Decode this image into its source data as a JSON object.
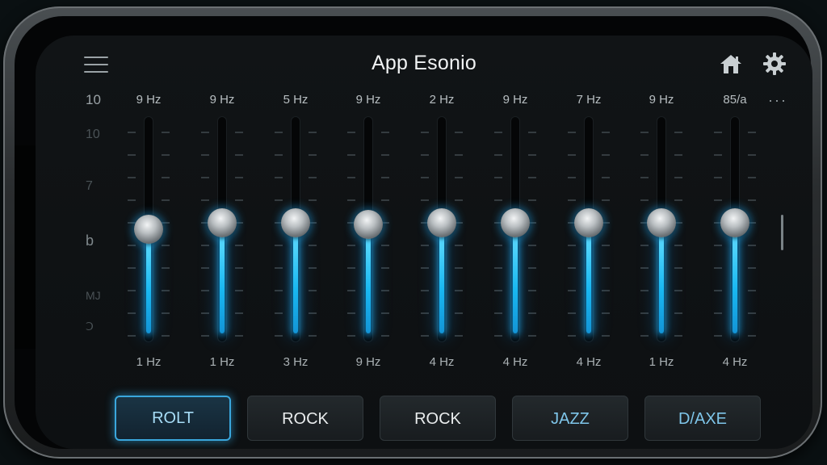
{
  "app": {
    "title": "App Esonio",
    "more_label": "···"
  },
  "icons": {
    "menu": "hamburger-menu-icon",
    "home": "home-icon",
    "settings": "gear-icon",
    "more": "more-dots-icon"
  },
  "scale": {
    "labels": [
      "10",
      "10",
      "7",
      "b",
      "MJ",
      "Ↄ"
    ]
  },
  "bands": [
    {
      "top": "9 Hz",
      "bottom": "1 Hz",
      "level": 0.5
    },
    {
      "top": "9 Hz",
      "bottom": "1 Hz",
      "level": 0.53
    },
    {
      "top": "5 Hz",
      "bottom": "3 Hz",
      "level": 0.53
    },
    {
      "top": "9 Hz",
      "bottom": "9 Hz",
      "level": 0.52
    },
    {
      "top": "2 Hz",
      "bottom": "4 Hz",
      "level": 0.53
    },
    {
      "top": "9 Hz",
      "bottom": "4 Hz",
      "level": 0.53
    },
    {
      "top": "7 Hz",
      "bottom": "4 Hz",
      "level": 0.53
    },
    {
      "top": "9 Hz",
      "bottom": "1 Hz",
      "level": 0.53
    },
    {
      "top": "85/a",
      "bottom": "4 Hz",
      "level": 0.53
    }
  ],
  "presets": [
    {
      "label": "ROLT",
      "active": true
    },
    {
      "label": "ROCK",
      "active": false
    },
    {
      "label": "ROCK",
      "active": false
    },
    {
      "label": "JAZZ",
      "active": false
    },
    {
      "label": "D/AXE",
      "active": false
    }
  ],
  "colors": {
    "accent": "#19b8f2",
    "active_border": "#3aa7dd",
    "background": "#0d1012"
  }
}
